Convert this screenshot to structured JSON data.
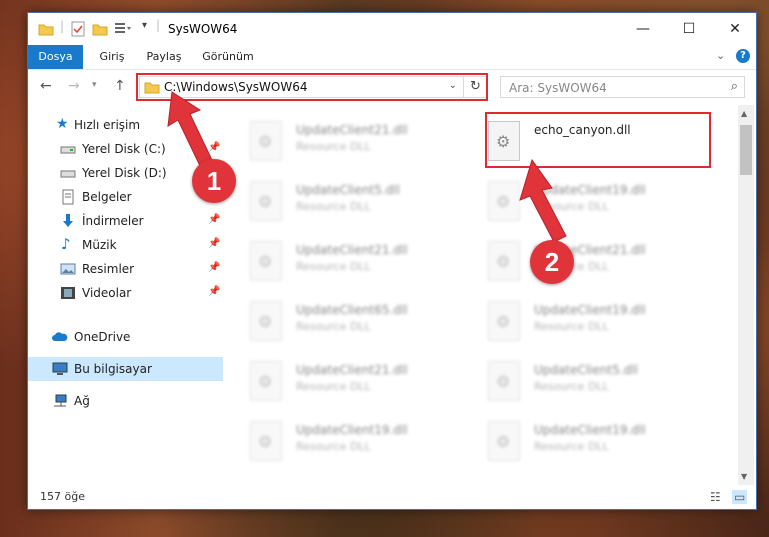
{
  "window": {
    "title": "SysWOW64",
    "controls": [
      "minimize-icon",
      "maximize-icon",
      "close-icon"
    ]
  },
  "ribbon": {
    "tabs": [
      {
        "label": "Dosya"
      },
      {
        "label": "Giriş"
      },
      {
        "label": "Paylaş"
      },
      {
        "label": "Görünüm"
      }
    ]
  },
  "address": {
    "path": "C:\\Windows\\SysWOW64",
    "search_placeholder": "Ara: SysWOW64"
  },
  "sidebar": {
    "items": [
      {
        "label": "Hızlı erişim",
        "icon": "star-icon"
      },
      {
        "label": "Yerel Disk (C:)",
        "icon": "drive-icon"
      },
      {
        "label": "Yerel Disk (D:)",
        "icon": "drive-icon"
      },
      {
        "label": "Belgeler",
        "icon": "documents-icon"
      },
      {
        "label": "İndirmeler",
        "icon": "download-icon"
      },
      {
        "label": "Müzik",
        "icon": "music-icon"
      },
      {
        "label": "Resimler",
        "icon": "pictures-icon"
      },
      {
        "label": "Videolar",
        "icon": "videos-icon"
      },
      {
        "label": "OneDrive",
        "icon": "cloud-icon"
      },
      {
        "label": "Bu bilgisayar",
        "icon": "computer-icon"
      },
      {
        "label": "Ağ",
        "icon": "network-icon"
      }
    ]
  },
  "files": [
    {
      "name": "UpdateClient21.dll",
      "type": "Resource DLL"
    },
    {
      "name": "echo_canyon.dll",
      "type": ""
    },
    {
      "name": "UpdateClient5.dll",
      "type": "Resource DLL"
    },
    {
      "name": "UpdateClient19.dll",
      "type": "Resource DLL"
    },
    {
      "name": "UpdateClient21.dll",
      "type": "Resource DLL"
    },
    {
      "name": "UpdateClient21.dll",
      "type": "Resource DLL"
    },
    {
      "name": "UpdateClient65.dll",
      "type": "Resource DLL"
    },
    {
      "name": "UpdateClient19.dll",
      "type": "Resource DLL"
    },
    {
      "name": "UpdateClient21.dll",
      "type": "Resource DLL"
    },
    {
      "name": "UpdateClient5.dll",
      "type": "Resource DLL"
    },
    {
      "name": "UpdateClient19.dll",
      "type": "Resource DLL"
    },
    {
      "name": "UpdateClient19.dll",
      "type": "Resource DLL"
    }
  ],
  "status": {
    "item_count": "157 öğe"
  },
  "annotations": {
    "step1": "1",
    "step2": "2",
    "color": "#e0343a"
  }
}
